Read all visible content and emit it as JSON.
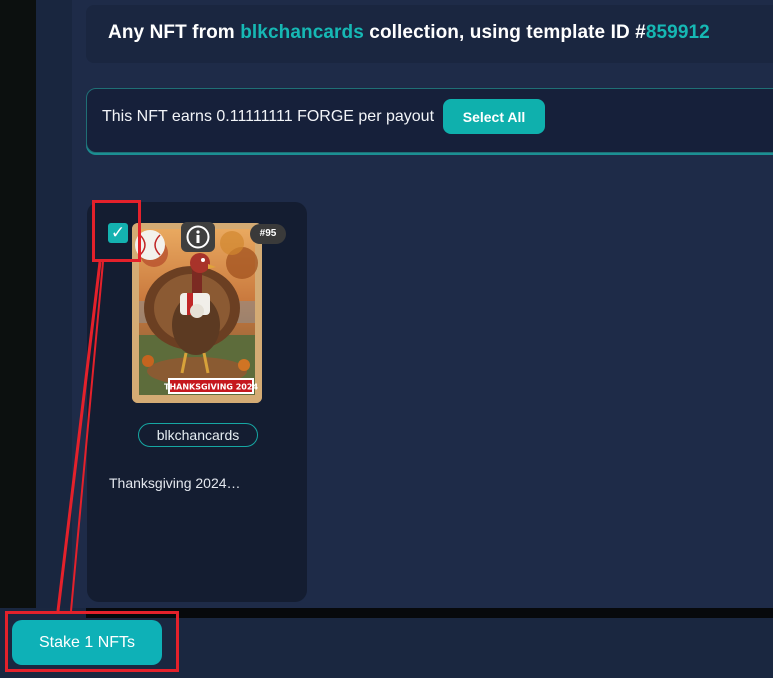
{
  "header": {
    "title_prefix": "Any NFT from",
    "collection": "blkchancards",
    "title_middle": "collection, using template ID #",
    "template_id": "859912"
  },
  "earnings": {
    "text": "This NFT earns 0.11111111 FORGE per payout",
    "select_all_label": "Select All"
  },
  "nft": {
    "selected": true,
    "checkbox_glyph": "✓",
    "badge": "#95",
    "banner_text": "THANKSGIVING 2024",
    "collection": "blkchancards",
    "name": "Thanksgiving 2024…",
    "info_icon": "info-icon"
  },
  "footer": {
    "stake_label": "Stake 1 NFTs"
  },
  "colors": {
    "accent": "#16b8b4",
    "button": "#0fb0ad",
    "highlight": "#e4212b"
  }
}
